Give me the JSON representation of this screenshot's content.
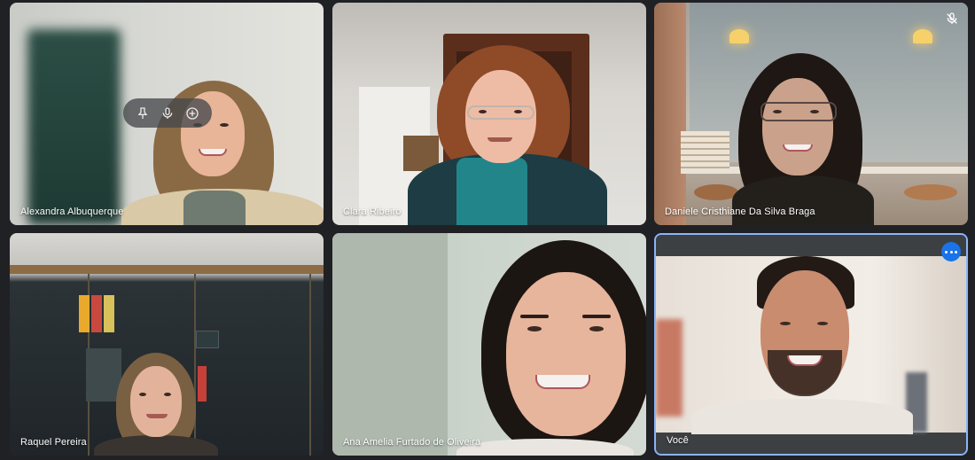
{
  "participants": [
    {
      "name": "Alexandra Albuquerque",
      "hover_controls": [
        "pin-icon",
        "mic-icon",
        "more-options-icon"
      ]
    },
    {
      "name": "Clara Ribeiro"
    },
    {
      "name": "Daniele Cristhiane Da Silva Braga",
      "muted": true
    },
    {
      "name": "Raquel Pereira"
    },
    {
      "name": "Ana Amelia Furtado de Oliveira"
    },
    {
      "name": "Você",
      "is_self": true,
      "highlighted": true
    }
  ],
  "colors": {
    "background": "#202124",
    "self_highlight": "#8ab4f8",
    "more_button": "#1a73e8"
  }
}
